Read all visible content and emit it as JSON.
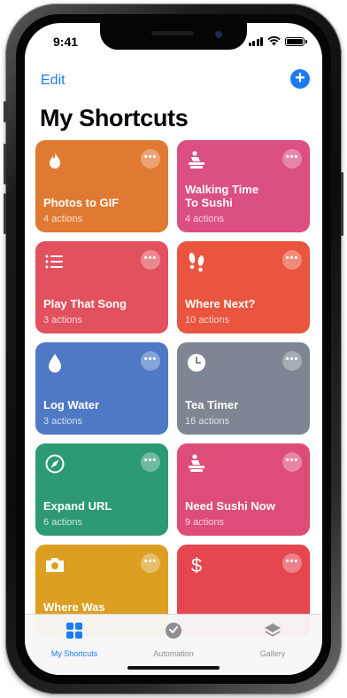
{
  "status_bar": {
    "time": "9:41",
    "signal": "signal-bars-icon",
    "wifi": "wifi-icon",
    "battery": "battery-icon"
  },
  "header": {
    "edit_label": "Edit",
    "add_button": "+",
    "title": "My Shortcuts"
  },
  "cards": [
    {
      "name_line1": "Photos to GIF",
      "name_line2": "",
      "count": "4 actions",
      "icon": "flame-icon",
      "color": "#e07a33"
    },
    {
      "name_line1": "Walking Time",
      "name_line2": "To Sushi",
      "count": "4 actions",
      "icon": "sushi-icon",
      "color": "#db4f82"
    },
    {
      "name_line1": "Play That Song",
      "name_line2": "",
      "count": "3 actions",
      "icon": "list-icon",
      "color": "#e2525e"
    },
    {
      "name_line1": "Where Next?",
      "name_line2": "",
      "count": "10 actions",
      "icon": "footprints-icon",
      "color": "#e9553f"
    },
    {
      "name_line1": "Log Water",
      "name_line2": "",
      "count": "3 actions",
      "icon": "water-drop-icon",
      "color": "#4f79c4"
    },
    {
      "name_line1": "Tea Timer",
      "name_line2": "",
      "count": "16 actions",
      "icon": "clock-icon",
      "color": "#7d8692"
    },
    {
      "name_line1": "Expand URL",
      "name_line2": "",
      "count": "6 actions",
      "icon": "compass-icon",
      "color": "#2e9a74"
    },
    {
      "name_line1": "Need Sushi Now",
      "name_line2": "",
      "count": "9 actions",
      "icon": "sushi-icon",
      "color": "#dd4d78"
    },
    {
      "name_line1": "Where Was",
      "name_line2": "",
      "count": "",
      "icon": "camera-icon",
      "color": "#dc9f22"
    },
    {
      "name_line1": "",
      "name_line2": "",
      "count": "",
      "icon": "dollar-icon",
      "color": "#e5464f"
    }
  ],
  "tabs": [
    {
      "label": "My Shortcuts",
      "icon": "grid-icon",
      "active": true
    },
    {
      "label": "Automation",
      "icon": "automation-icon",
      "active": false
    },
    {
      "label": "Gallery",
      "icon": "layers-icon",
      "active": false
    }
  ],
  "colors": {
    "accent": "#1a7cf0",
    "inactive_tab": "#8e8e93"
  }
}
